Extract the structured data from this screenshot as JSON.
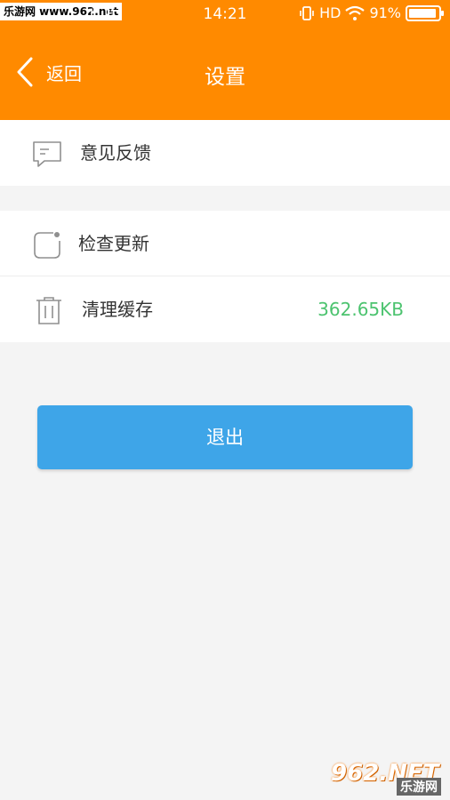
{
  "status_bar": {
    "watermark": "乐游网 www.962.net",
    "carrier": "II",
    "time": "14:21",
    "network": "HD",
    "battery": "91%"
  },
  "nav": {
    "back_label": "返回",
    "title": "设置"
  },
  "settings": {
    "feedback_label": "意见反馈",
    "update_label": "检查更新",
    "cache_label": "清理缓存",
    "cache_size": "362.65KB"
  },
  "logout_label": "退出",
  "watermark_br": {
    "brand": "962.NET",
    "cn": "乐游网"
  },
  "colors": {
    "header": "#ff8a00",
    "button": "#3ea5e8",
    "cache_value": "#4cc36f"
  }
}
